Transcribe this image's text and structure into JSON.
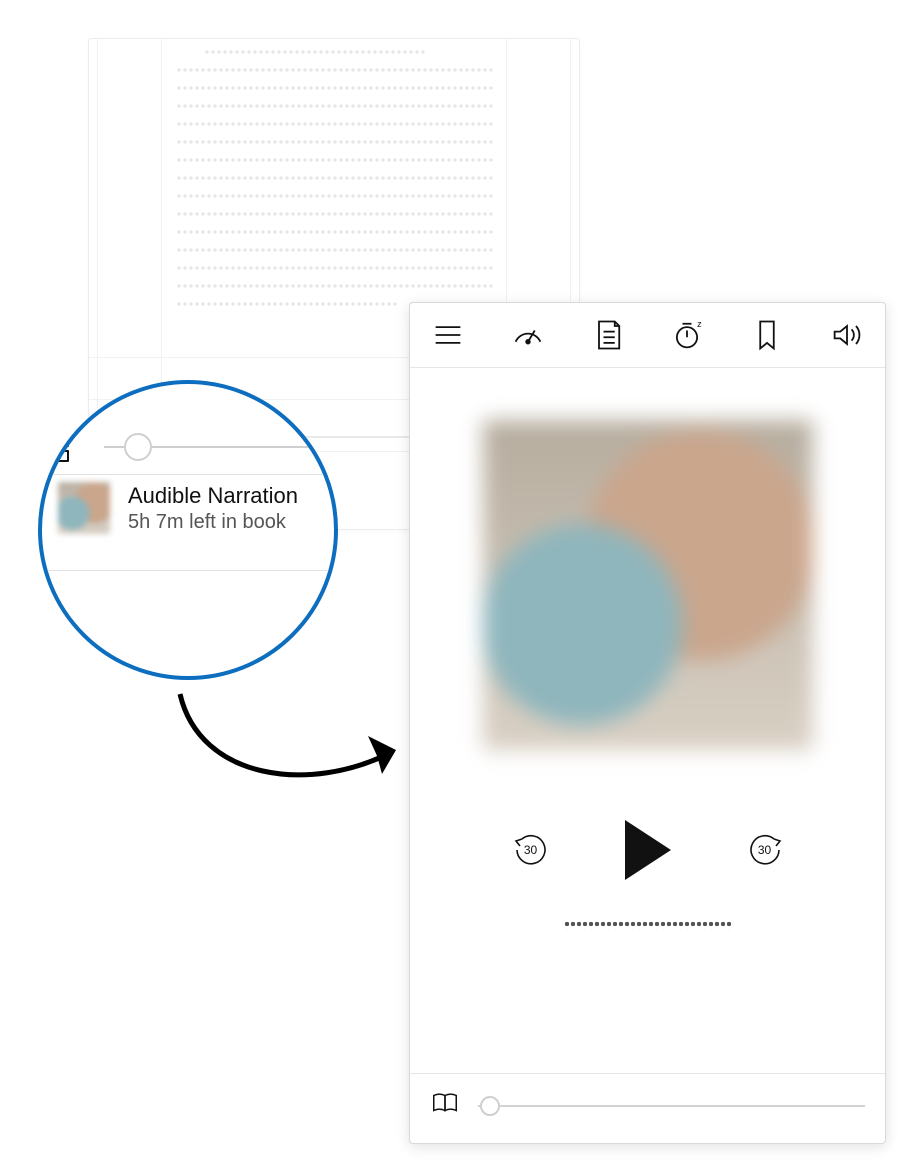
{
  "reader": {
    "progress_slider_percent": 7
  },
  "callout": {
    "grid_icon": "library-grid-icon",
    "title": "Audible Narration",
    "subtitle": "5h 7m left in book",
    "slider_percent": 11
  },
  "player": {
    "toolbar_icons": {
      "menu": "menu-icon",
      "speed": "speed-icon",
      "chapters": "chapters-icon",
      "sleep": "sleep-timer-icon",
      "bookmark": "bookmark-icon",
      "volume": "volume-icon"
    },
    "skip_back_seconds": "30",
    "skip_forward_seconds": "30",
    "playback_progress_percent": 3,
    "switch_to_reader_icon": "open-book-icon"
  }
}
